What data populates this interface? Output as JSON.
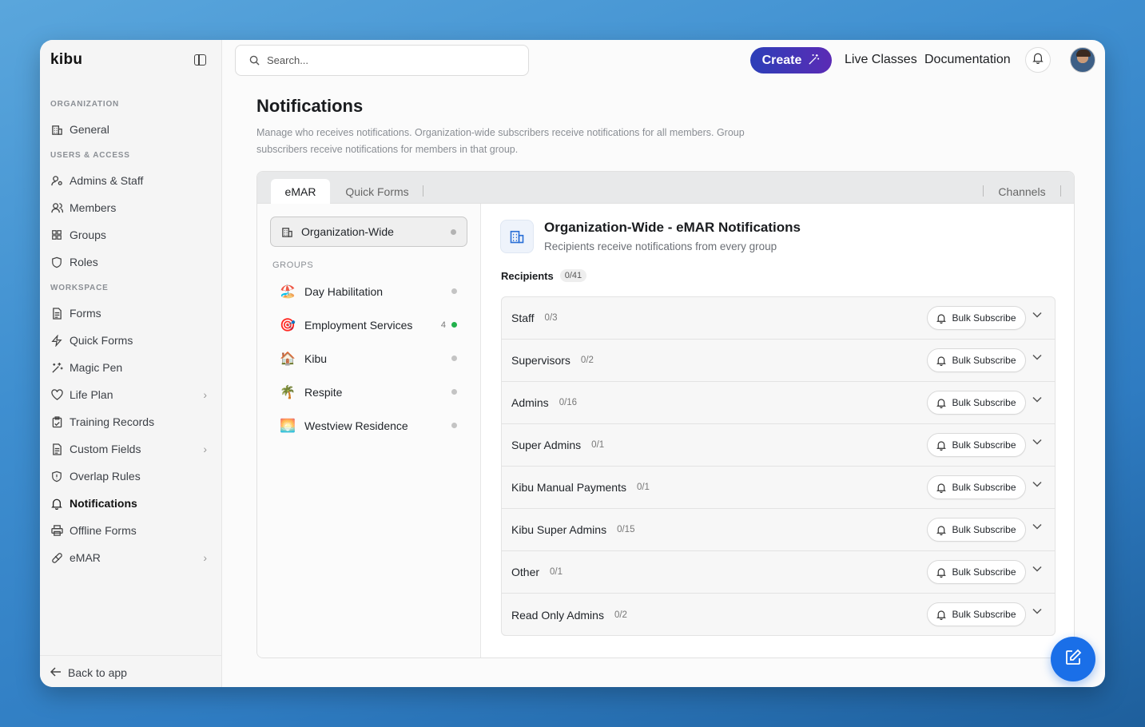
{
  "app": {
    "brand": "kibu"
  },
  "sidebar": {
    "sections": [
      {
        "label": "ORGANIZATION"
      },
      {
        "label": "USERS & ACCESS"
      },
      {
        "label": "WORKSPACE"
      }
    ],
    "items": [
      {
        "label": "General",
        "icon": "building-icon"
      },
      {
        "label": "Admins & Staff",
        "icon": "user-key-icon"
      },
      {
        "label": "Members",
        "icon": "users-icon"
      },
      {
        "label": "Groups",
        "icon": "grid-icon"
      },
      {
        "label": "Roles",
        "icon": "shield-icon"
      },
      {
        "label": "Forms",
        "icon": "file-icon"
      },
      {
        "label": "Quick Forms",
        "icon": "bolt-icon"
      },
      {
        "label": "Magic Pen",
        "icon": "sparkle-icon"
      },
      {
        "label": "Life Plan",
        "icon": "heart-icon"
      },
      {
        "label": "Training Records",
        "icon": "clipboard-icon"
      },
      {
        "label": "Custom Fields",
        "icon": "file-icon"
      },
      {
        "label": "Overlap Rules",
        "icon": "shield-alert-icon"
      },
      {
        "label": "Notifications",
        "icon": "bell-icon"
      },
      {
        "label": "Offline Forms",
        "icon": "printer-icon"
      },
      {
        "label": "eMAR",
        "icon": "pill-icon"
      }
    ],
    "back": "Back to app"
  },
  "topbar": {
    "search_placeholder": "Search...",
    "create": "Create",
    "live_classes": "Live Classes",
    "documentation": "Documentation"
  },
  "page": {
    "title": "Notifications",
    "description": "Manage who receives notifications. Organization-wide subscribers receive notifications for all members. Group subscribers receive notifications for members in that group."
  },
  "tabs": {
    "emar": "eMAR",
    "quick_forms": "Quick Forms",
    "channels": "Channels"
  },
  "left": {
    "org_wide": "Organization-Wide",
    "groups_header": "GROUPS",
    "groups": [
      {
        "name": "Day Habilitation",
        "emoji": "🏖️",
        "count": "",
        "status": "#c4c4c4"
      },
      {
        "name": "Employment Services",
        "emoji": "🎯",
        "count": "4",
        "status": "#22b14c"
      },
      {
        "name": "Kibu",
        "emoji": "🏠",
        "count": "",
        "status": "#c4c4c4"
      },
      {
        "name": "Respite",
        "emoji": "🌴",
        "count": "",
        "status": "#c4c4c4"
      },
      {
        "name": "Westview Residence",
        "emoji": "🌅",
        "count": "",
        "status": "#c4c4c4"
      }
    ]
  },
  "detail": {
    "title": "Organization-Wide - eMAR Notifications",
    "subtitle": "Recipients receive notifications from every group",
    "recipients_label": "Recipients",
    "recipients_count": "0/41",
    "bulk_label": "Bulk Subscribe",
    "rows": [
      {
        "name": "Staff",
        "count": "0/3"
      },
      {
        "name": "Supervisors",
        "count": "0/2"
      },
      {
        "name": "Admins",
        "count": "0/16"
      },
      {
        "name": "Super Admins",
        "count": "0/1"
      },
      {
        "name": "Kibu Manual Payments",
        "count": "0/1"
      },
      {
        "name": "Kibu Super Admins",
        "count": "0/15"
      },
      {
        "name": "Other",
        "count": "0/1"
      },
      {
        "name": "Read Only Admins",
        "count": "0/2"
      }
    ]
  },
  "colors": {
    "accent": "#1a6fe8",
    "create_start": "#2c3fb8",
    "create_end": "#5b2bb5",
    "active_dot": "#22b14c"
  }
}
